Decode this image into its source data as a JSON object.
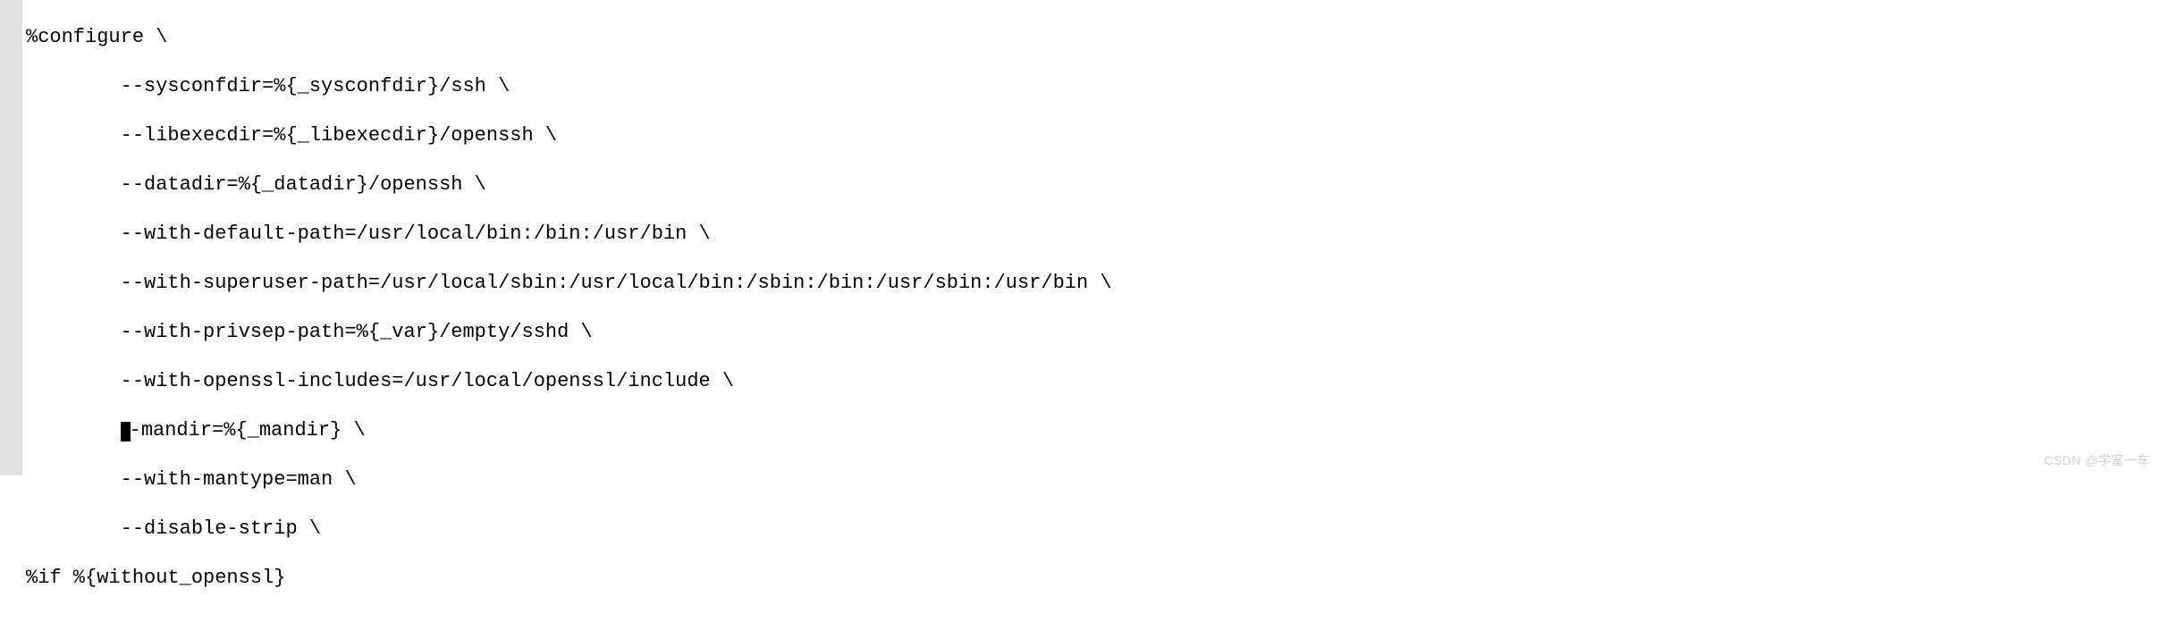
{
  "code": {
    "lines": [
      "%configure \\",
      "        --sysconfdir=%{_sysconfdir}/ssh \\",
      "        --libexecdir=%{_libexecdir}/openssh \\",
      "        --datadir=%{_datadir}/openssh \\",
      "        --with-default-path=/usr/local/bin:/bin:/usr/bin \\",
      "        --with-superuser-path=/usr/local/sbin:/usr/local/bin:/sbin:/bin:/usr/sbin:/usr/bin \\",
      "        --with-privsep-path=%{_var}/empty/sshd \\",
      "        --with-openssl-includes=/usr/local/openssl/include \\",
      "",
      "        --with-mantype=man \\",
      "        --disable-strip \\",
      "%if %{without_openssl}"
    ],
    "cursor_line_prefix": "        ",
    "cursor_line_suffix": "-mandir=%{_mandir} \\"
  },
  "watermark": "CSDN @学富一车"
}
